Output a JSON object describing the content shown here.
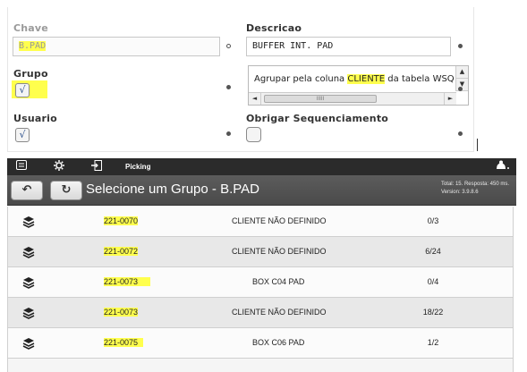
{
  "form": {
    "chave_label": "Chave",
    "chave_value": "B.PAD",
    "descricao_label": "Descricao",
    "descricao_value": "BUFFER INT. PAD",
    "grupo_label": "Grupo",
    "grupo_checked": "√",
    "grupo_text_pre": "Agrupar pela coluna ",
    "grupo_text_hl": "CLIENTE",
    "grupo_text_post": " da tabela WSQ",
    "scroll_up": "▲",
    "scroll_down": "▼",
    "scroll_left": "◄",
    "scroll_right": "►",
    "scroll_thumb_grip": "IIIII",
    "usuario_label": "Usuario",
    "usuario_checked": "√",
    "obrigar_label": "Obrigar Sequenciamento"
  },
  "toolbar": {
    "label": "Picking",
    "icons": [
      "menu-icon",
      "gear-icon",
      "logout-icon",
      "user-icon"
    ]
  },
  "header": {
    "back_glyph": "↶",
    "refresh_glyph": "↻",
    "title": "Selecione um Grupo - B.PAD",
    "info_line1": "Total: 15. Resposta: 450 ms.",
    "info_line2": "Version: 3.9.8.6"
  },
  "rows": [
    {
      "code": "221-0070",
      "desc": "CLIENTE NÃO DEFINIDO",
      "ratio": "0/3"
    },
    {
      "code": "221-0072",
      "desc": "CLIENTE NÃO DEFINIDO",
      "ratio": "6/24"
    },
    {
      "code": "221-0073",
      "desc": "BOX C04 PAD",
      "ratio": "0/4"
    },
    {
      "code": "221-0073",
      "desc": "CLIENTE NÃO DEFINIDO",
      "ratio": "18/22"
    },
    {
      "code": "221-0075",
      "desc": "BOX C06 PAD",
      "ratio": "1/2"
    }
  ],
  "colors": {
    "highlight": "#ffff4d",
    "toolbar_bg": "#2b2b2b",
    "header_bg": "#555555"
  }
}
